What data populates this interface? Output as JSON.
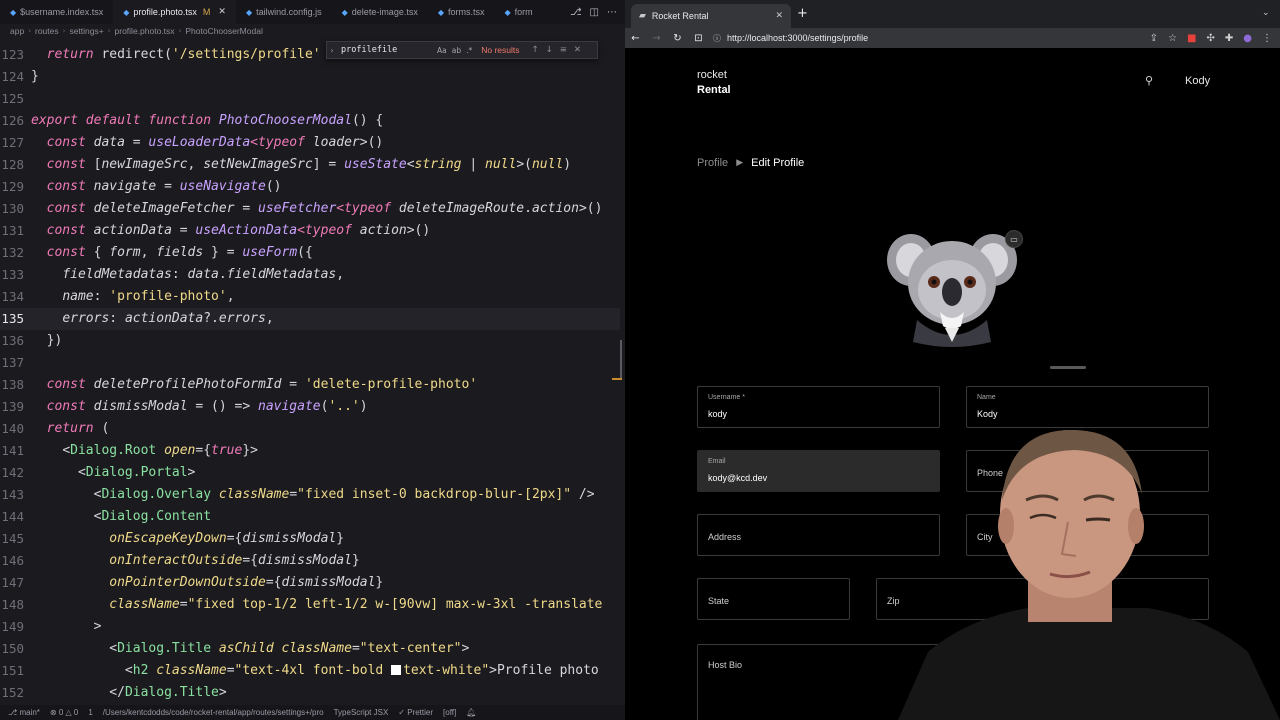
{
  "editor": {
    "tabs": [
      {
        "label": "$username.index.tsx",
        "active": false
      },
      {
        "label": "profile.photo.tsx",
        "modified": "M",
        "active": true
      },
      {
        "label": "tailwind.config.js",
        "active": false
      },
      {
        "label": "delete-image.tsx",
        "active": false
      },
      {
        "label": "forms.tsx",
        "active": false
      },
      {
        "label": "form",
        "active": false
      }
    ],
    "breadcrumb": [
      "app",
      "routes",
      "settings+",
      "profile.photo.tsx",
      "PhotoChooserModal"
    ],
    "find": {
      "value": "profilefile",
      "option_case": "Aa",
      "option_word": "ab",
      "option_regex": ".*",
      "result": "No results"
    },
    "current_line": "135",
    "lines": [
      {
        "n": "123"
      },
      {
        "n": "124"
      },
      {
        "n": "125"
      },
      {
        "n": "126"
      },
      {
        "n": "127"
      },
      {
        "n": "128"
      },
      {
        "n": "129"
      },
      {
        "n": "130"
      },
      {
        "n": "131"
      },
      {
        "n": "132"
      },
      {
        "n": "133"
      },
      {
        "n": "134"
      },
      {
        "n": "135"
      },
      {
        "n": "136"
      },
      {
        "n": "137"
      },
      {
        "n": "138"
      },
      {
        "n": "139"
      },
      {
        "n": "140"
      },
      {
        "n": "141"
      },
      {
        "n": "142"
      },
      {
        "n": "143"
      },
      {
        "n": "144"
      },
      {
        "n": "145"
      },
      {
        "n": "146"
      },
      {
        "n": "147"
      },
      {
        "n": "148"
      },
      {
        "n": "149"
      },
      {
        "n": "150"
      },
      {
        "n": "151"
      },
      {
        "n": "152"
      }
    ],
    "code_tokens": {
      "l123": [
        "return",
        " redirect(",
        "'/settings/profile'"
      ],
      "l124": "}",
      "l126": [
        "export",
        " ",
        "default",
        " ",
        "function",
        " ",
        "PhotoChooserModal",
        "() {"
      ],
      "l127": [
        "const",
        " ",
        "data",
        " = ",
        "useLoaderData",
        "<typeof ",
        "loader",
        ">()"
      ],
      "l128": [
        "const",
        " [",
        "newImageSrc",
        ", ",
        "setNewImageSrc",
        "] = ",
        "useState",
        "<",
        "string",
        " | ",
        "null",
        ">(",
        "null",
        ")"
      ],
      "l129": [
        "const",
        " ",
        "navigate",
        " = ",
        "useNavigate",
        "()"
      ],
      "l130": [
        "const",
        " ",
        "deleteImageFetcher",
        " = ",
        "useFetcher",
        "<typeof ",
        "deleteImageRoute",
        ".",
        "action",
        ">()"
      ],
      "l131": [
        "const",
        " ",
        "actionData",
        " = ",
        "useActionData",
        "<typeof ",
        "action",
        ">()"
      ],
      "l132": [
        "const",
        " { ",
        "form",
        ", ",
        "fields",
        " } = ",
        "useForm",
        "({"
      ],
      "l133": [
        "fieldMetadatas",
        ": ",
        "data",
        ".",
        "fieldMetadatas",
        ","
      ],
      "l134": [
        "name",
        ": ",
        "'profile-photo'",
        ","
      ],
      "l135": [
        "errors",
        ": ",
        "actionData",
        "?.",
        "errors",
        ","
      ],
      "l136": "})",
      "l138": [
        "const",
        " ",
        "deleteProfilePhotoFormId",
        " = ",
        "'delete-profile-photo'"
      ],
      "l139": [
        "const",
        " ",
        "dismissModal",
        " = () => ",
        "navigate",
        "(",
        "'..'",
        ")"
      ],
      "l140": [
        "return",
        " ("
      ],
      "l141": [
        "<",
        "Dialog.Root",
        " ",
        "open",
        "={",
        "true",
        "}>"
      ],
      "l142": [
        "<",
        "Dialog.Portal",
        ">"
      ],
      "l143": [
        "<",
        "Dialog.Overlay",
        " ",
        "className",
        "=",
        "\"fixed inset-0 backdrop-blur-[2px]\"",
        " />"
      ],
      "l144": [
        "<",
        "Dialog.Content"
      ],
      "l145": [
        "onEscapeKeyDown",
        "={",
        "dismissModal",
        "}"
      ],
      "l146": [
        "onInteractOutside",
        "={",
        "dismissModal",
        "}"
      ],
      "l147": [
        "onPointerDownOutside",
        "={",
        "dismissModal",
        "}"
      ],
      "l148": [
        "className",
        "=",
        "\"fixed top-1/2 left-1/2 w-[90vw] max-w-3xl -translate"
      ],
      "l149": ">",
      "l150": [
        "<",
        "Dialog.Title",
        " ",
        "asChild",
        " ",
        "className",
        "=",
        "\"text-center\"",
        ">"
      ],
      "l151": [
        "<",
        "h2",
        " ",
        "className",
        "=",
        "\"text-4xl font-bold ",
        "text-white\"",
        ">Profile photo"
      ],
      "l152": [
        "</",
        "Dialog.Title",
        ">"
      ]
    },
    "status": {
      "branch": "main*",
      "problems": "0 △ 0",
      "info": "1",
      "path": "/Users/kentcdodds/code/rocket-rental/app/routes/settings+/pro",
      "language": "TypeScript JSX",
      "formatter": "Prettier",
      "spell": "[off]"
    }
  },
  "browser": {
    "tab_title": "Rocket Rental",
    "url": "http://localhost:3000/settings/profile",
    "page": {
      "logo_line1": "rocket",
      "logo_line2": "Rental",
      "nav_user": "Kody",
      "breadcrumb_profile": "Profile",
      "breadcrumb_edit": "Edit Profile",
      "fields": {
        "username": {
          "label": "Username *",
          "value": "kody"
        },
        "name": {
          "label": "Name",
          "value": "Kody"
        },
        "email": {
          "label": "Email",
          "value": "kody@kcd.dev"
        },
        "phone": {
          "placeholder": "Phone"
        },
        "address": {
          "placeholder": "Address"
        },
        "city": {
          "placeholder": "City"
        },
        "state": {
          "placeholder": "State"
        },
        "zip": {
          "placeholder": "Zip"
        },
        "host_bio": {
          "placeholder": "Host Bio"
        }
      }
    }
  },
  "colors": {
    "editor_bg": "#1b1b1f",
    "keyword": "#f07ab8",
    "function": "#c8a2ff",
    "string": "#f0d98a",
    "tag": "#8ae0a0",
    "browser_chrome": "#35363a",
    "page_bg": "#000000"
  },
  "icons": {
    "find_close": "close-icon",
    "avatar_edit": "camera-icon",
    "nav_search": "search-icon"
  }
}
